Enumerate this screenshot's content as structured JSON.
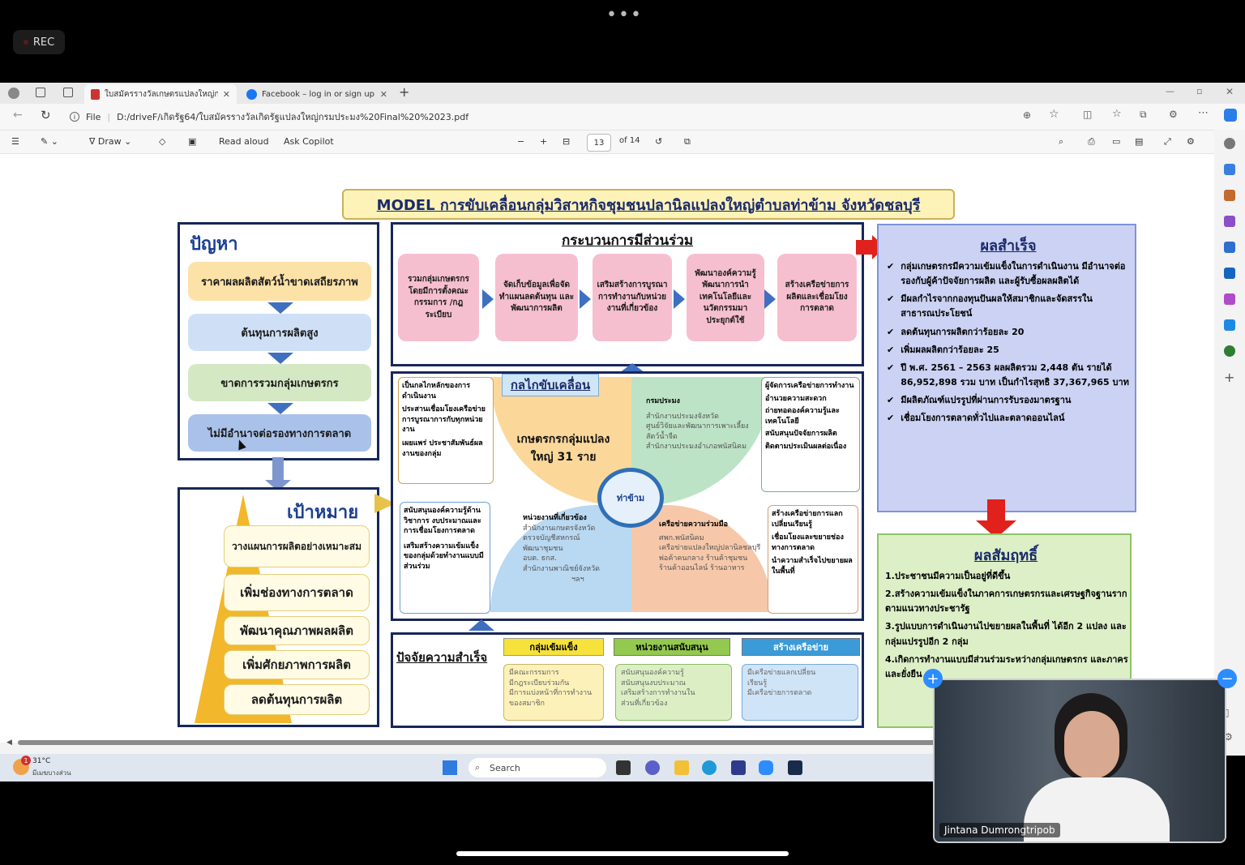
{
  "top": {
    "dots": "•••",
    "rec": "REC"
  },
  "tabs": [
    {
      "label": "ใบสมัครรางวัลเกษตรแปลงใหญ่กรมประ"
    },
    {
      "label": "Facebook – log in or sign up"
    }
  ],
  "address": {
    "scheme": "File",
    "path": "D:/driveF/เกิดรัฐ64/ใบสมัครรางวัลเกิดรัฐแปลงใหญ่กรมประมง%20Final%20%2023.pdf"
  },
  "pdf_toolbar": {
    "draw": "Draw",
    "read_aloud": "Read aloud",
    "ask_copilot": "Ask Copilot",
    "page": "13",
    "of": "of 14"
  },
  "diagram": {
    "title": "MODEL การขับเคลื่อนกลุ่มวิสาหกิจชุมชนปลานิลแปลงใหญ่ตำบลท่าข้าม จังหวัดชลบุรี",
    "problem": {
      "heading": "ปัญหา",
      "items": [
        "ราคาผลผลิตสัตว์น้ำขาดเสถียรภาพ",
        "ต้นทุนการผลิตสูง",
        "ขาดการรวมกลุ่มเกษตรกร",
        "ไม่มีอำนาจต่อรองทางการตลาด"
      ]
    },
    "goal": {
      "heading": "เป้าหมาย",
      "items": [
        "วางแผนการผลิตอย่างเหมาะสม",
        "เพิ่มช่องทางการตลาด",
        "พัฒนาคุณภาพผลผลิต",
        "เพิ่มศักยภาพการผลิต",
        "ลดต้นทุนการผลิต"
      ]
    },
    "process": {
      "heading": "กระบวนการมีส่วนร่วม",
      "steps": [
        "รวมกลุ่มเกษตรกร โดยมีการตั้งคณะกรรมการ /กฎระเบียบ",
        "จัดเก็บข้อมูลเพื่อจัดทำแผนลดต้นทุน และพัฒนาการผลิต",
        "เสริมสร้างการบูรณาการทำงานกับหน่วยงานที่เกี่ยวข้อง",
        "พัฒนาองค์ความรู้ พัฒนาการนำเทคโนโลยีและนวัตกรรมมาประยุกต์ใช้",
        "สร้างเครือข่ายการผลิตและเชื่อมโยงการตลาด"
      ]
    },
    "mechanism": {
      "heading": "กลไกขับเคลื่อน",
      "center": "เกษตรกรกลุ่มแปลงใหญ่ 31 ราย",
      "logo": "ท่าข้าม",
      "tl": [
        "เป็นกลไกหลักของการดำเนินงาน",
        "ประสานเชื่อมโยงเครือข่ายการบูรณาการกับทุกหน่วยงาน",
        "เผยแพร่ ประชาสัมพันธ์ผลงานของกลุ่ม"
      ],
      "tr_title": "กรมประมง",
      "tr_text": [
        "สำนักงานประมงจังหวัด",
        "ศูนย์วิจัยและพัฒนาการเพาะเลี้ยงสัตว์น้ำจืด",
        "สำนักงานประมงอำเภอพนัสนิคม"
      ],
      "tr_checks": [
        "ผู้จัดการเครือข่ายการทำงาน",
        "อำนวยความสะดวก",
        "ถ่ายทอดองค์ความรู้และเทคโนโลยี",
        "สนับสนุนปัจจัยการผลิต",
        "ติดตามประเมินผลต่อเนื่อง"
      ],
      "bl_checks": [
        "สนับสนุนองค์ความรู้ด้านวิชาการ งบประมาณและการเชื่อมโยงการตลาด",
        "เสริมสร้างความเข้มแข็งของกลุ่มด้วยทำงานแบบมีส่วนร่วม"
      ],
      "bl_title": "หน่วยงานที่เกี่ยวข้อง",
      "bl_text": [
        "สำนักงานเกษตรจังหวัด",
        "ตรวจบัญชีสหกรณ์",
        "พัฒนาชุมชน",
        "อบต.   ธกส.",
        "สำนักงานพาณิชย์จังหวัด",
        "ฯลฯ"
      ],
      "br_title": "เครือข่ายความร่วมมือ",
      "br_text": [
        "ศพก.พนัสนิคม",
        "เครือข่ายแปลงใหญ่ปลานิลชลบุรี",
        "พ่อค้าคนกลาง ร้านค้าชุมชน",
        "ร้านค้าออนไลน์ ร้านอาหาร"
      ],
      "br_checks": [
        "สร้างเครือข่ายการแลกเปลี่ยนเรียนรู้",
        "เชื่อมโยงและขยายช่องทางการตลาด",
        "นำความสำเร็จไปขยายผลในพื้นที่"
      ]
    },
    "success_factors": {
      "heading": "ปัจจัยความสำเร็จ",
      "cols": [
        {
          "title": "กลุ่มเข้มแข็ง",
          "text": [
            "มีคณะกรรมการ",
            "มีกฎระเบียบร่วมกัน",
            "มีการแบ่งหน้าที่การทำงาน",
            "ของสมาชิก"
          ]
        },
        {
          "title": "หน่วยงานสนับสนุน",
          "text": [
            "สนับสนุนองค์ความรู้",
            "สนับสนุนงบประมาณ",
            "เสริมสร้างการทำงานใน",
            "ส่วนที่เกี่ยวข้อง"
          ]
        },
        {
          "title": "สร้างเครือข่าย",
          "text": [
            "มีเครือข่ายแลกเปลี่ยน",
            "เรียนรู้",
            "มีเครือข่ายการตลาด"
          ]
        }
      ]
    },
    "results": {
      "heading": "ผลสำเร็จ",
      "items": [
        "กลุ่มเกษตรกรมีความเข้มแข็งในการดำเนินงาน มีอำนาจต่อรองกับผู้ค้าปัจจัยการผลิต และผู้รับซื้อผลผลิตได้",
        "มีผลกำไรจากกองทุนปันผลให้สมาชิกและจัดสรรในสาธารณประโยชน์",
        "ลดต้นทุนการผลิตกว่าร้อยละ 20",
        "เพิ่มผลผลิตกว่าร้อยละ 25",
        "ปี พ.ศ. 2561 – 2563 ผลผลิตรวม 2,448 ตัน รายได้ 86,952,898 รวม บาท เป็นกำไรสุทธิ 37,367,965 บาท",
        "มีผลิตภัณฑ์แปรรูปที่ผ่านการรับรองมาตรฐาน",
        "เชื่อมโยงการตลาดทั่วไปและตลาดออนไลน์"
      ]
    },
    "outcome": {
      "heading": "ผลสัมฤทธิ์",
      "items": [
        "1.ประชาชนมีความเป็นอยู่ที่ดีขึ้น",
        "2.สร้างความเข้มแข็งในภาคการเกษตรกรและเศรษฐกิจฐานรากตามแนวทางประชารัฐ",
        "3.รูปแบบการดำเนินงานไปขยายผลในพื้นที่ ได้อีก 2 แปลง และกลุ่มแปรรูปอีก 2 กลุ่ม",
        "4.เกิดการทำงานแบบมีส่วนร่วมระหว่างกลุ่มเกษตรกร และภาคร",
        "และยั่งยืน"
      ]
    }
  },
  "taskbar": {
    "temp": "31°C",
    "weather": "มีเมฆบางส่วน",
    "search": "Search",
    "badge": "1"
  },
  "video": {
    "name": "Jintana Dumrongtripob"
  },
  "colors": {
    "navy": "#17275a",
    "blue_arrow": "#3e6fc1",
    "red_arrow": "#e0211c"
  }
}
